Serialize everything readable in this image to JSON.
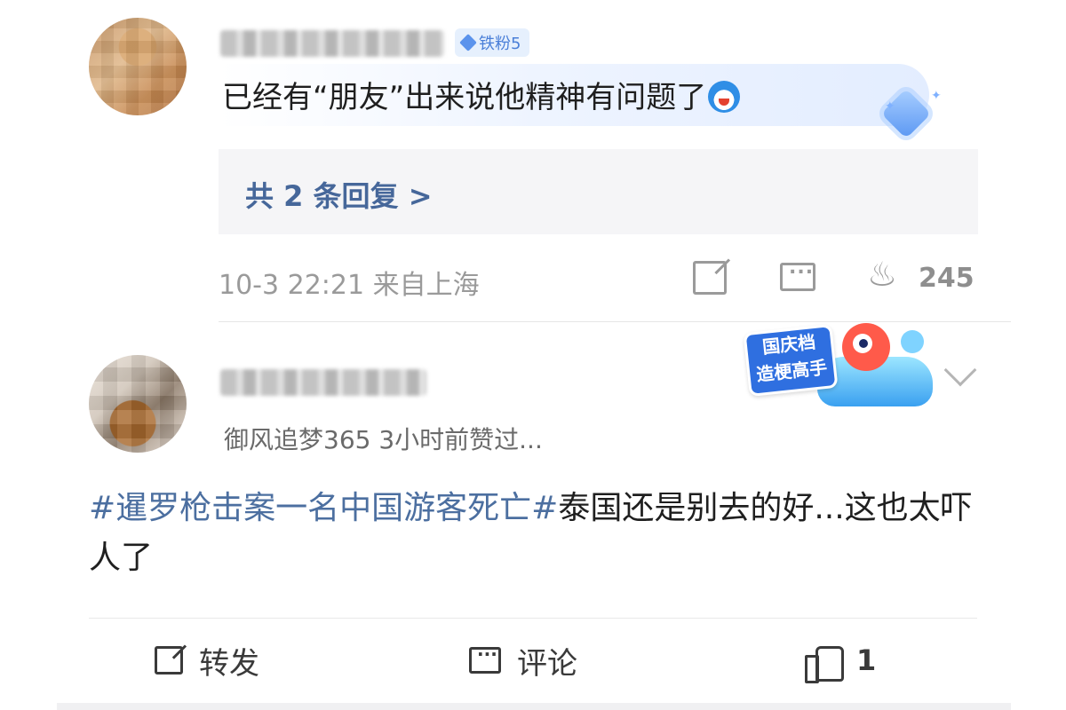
{
  "comment1": {
    "badge": "铁粉5",
    "text": "已经有“朋友”出来说他精神有问题了",
    "replies_link": "共 2 条回复 >",
    "timestamp": "10-3 22:21 来自上海",
    "hot_count": "245"
  },
  "post": {
    "sticker_text": "国庆档造梗高手",
    "liked_by": "御风追梦365 3小时前赞过...",
    "hashtag": "#暹罗枪击案一名中国游客死亡#",
    "body": "泰国还是别去的好...这也太吓人了",
    "repost_label": "转发",
    "comment_label": "评论",
    "like_count": "1"
  },
  "colors": {
    "link_blue": "#46679a",
    "hashtag_blue": "#4c6fa0",
    "badge_blue": "#4a7fd8",
    "muted_gray": "#9a9a9a"
  },
  "icons": [
    "share-icon",
    "comment-icon",
    "fire-icon",
    "chevron-down-icon",
    "like-icon",
    "gem-icon"
  ]
}
